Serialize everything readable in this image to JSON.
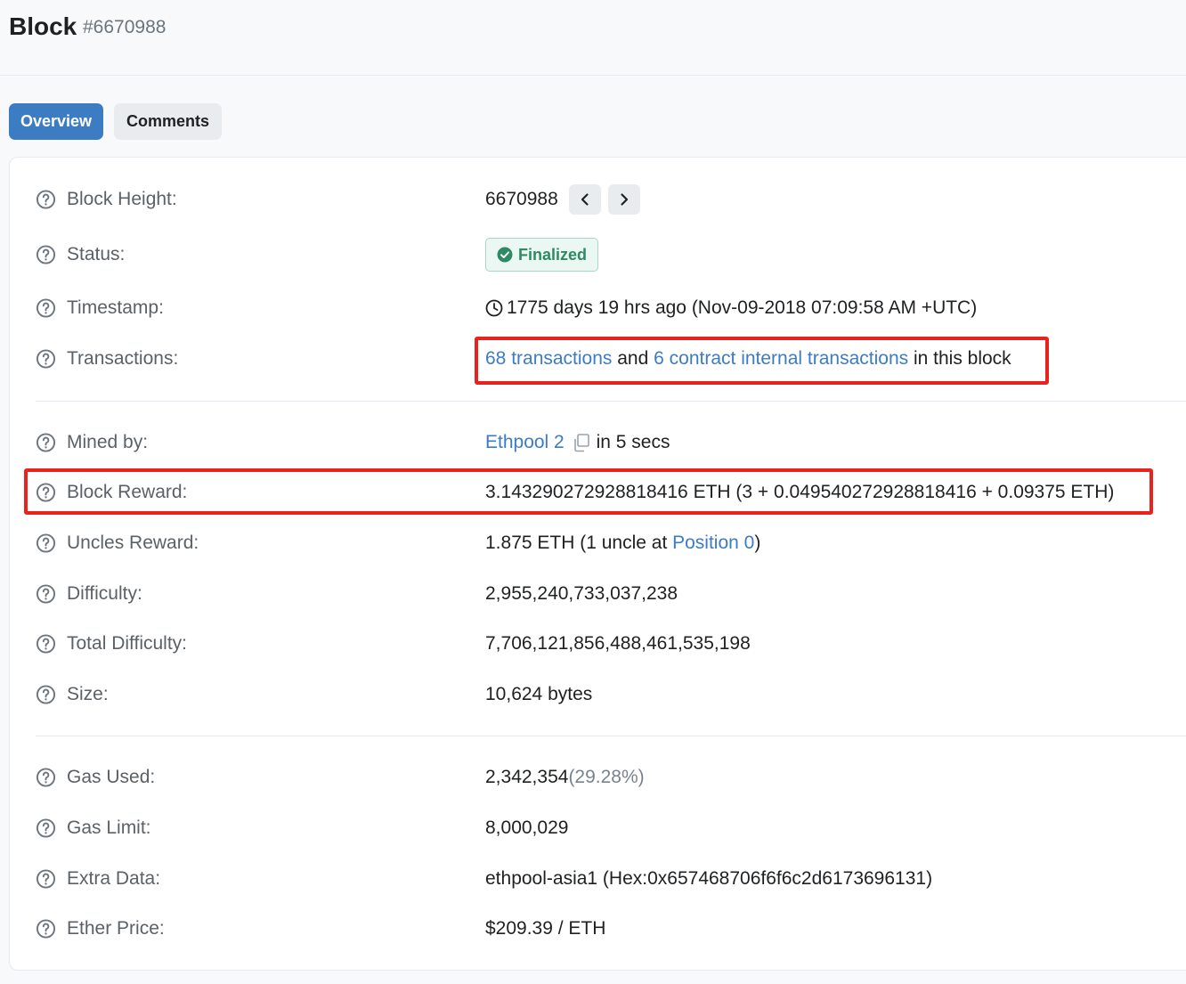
{
  "header": {
    "title": "Block",
    "block_number": "#6670988"
  },
  "tabs": [
    {
      "label": "Overview",
      "active": true
    },
    {
      "label": "Comments",
      "active": false
    }
  ],
  "rows": {
    "block_height": {
      "label": "Block Height:",
      "value": "6670988"
    },
    "status": {
      "label": "Status:",
      "value": "Finalized"
    },
    "timestamp": {
      "label": "Timestamp:",
      "value": "1775 days 19 hrs ago (Nov-09-2018 07:09:58 AM +UTC)"
    },
    "transactions": {
      "label": "Transactions:",
      "link1": "68 transactions",
      "and": " and ",
      "link2": "6 contract internal transactions",
      "suffix": " in this block"
    },
    "mined_by": {
      "label": "Mined by:",
      "link": "Ethpool 2",
      "suffix": " in 5 secs"
    },
    "block_reward": {
      "label": "Block Reward:",
      "value": "3.143290272928818416 ETH (3 + 0.049540272928818416 + 0.09375 ETH)"
    },
    "uncles_reward": {
      "label": "Uncles Reward:",
      "prefix": "1.875 ETH (1 uncle at ",
      "link": "Position 0",
      "suffix": ")"
    },
    "difficulty": {
      "label": "Difficulty:",
      "value": "2,955,240,733,037,238"
    },
    "total_difficulty": {
      "label": "Total Difficulty:",
      "value": "7,706,121,856,488,461,535,198"
    },
    "size": {
      "label": "Size:",
      "value": "10,624 bytes"
    },
    "gas_used": {
      "label": "Gas Used:",
      "value": "2,342,354",
      "percent": "(29.28%)"
    },
    "gas_limit": {
      "label": "Gas Limit:",
      "value": "8,000,029"
    },
    "extra_data": {
      "label": "Extra Data:",
      "value": "ethpool-asia1 (Hex:0x657468706f6f6c2d6173696131)"
    },
    "ether_price": {
      "label": "Ether Price:",
      "value": "$209.39 / ETH"
    }
  },
  "colors": {
    "link": "#3c7cc2",
    "primary": "#3c7cc2",
    "success": "#2e8a64",
    "highlight": "#e8221f"
  },
  "icons": {
    "help": "question-circle-icon",
    "clock": "clock-icon",
    "copy": "copy-icon",
    "check": "check-circle-icon",
    "prev": "chevron-left-icon",
    "next": "chevron-right-icon"
  }
}
